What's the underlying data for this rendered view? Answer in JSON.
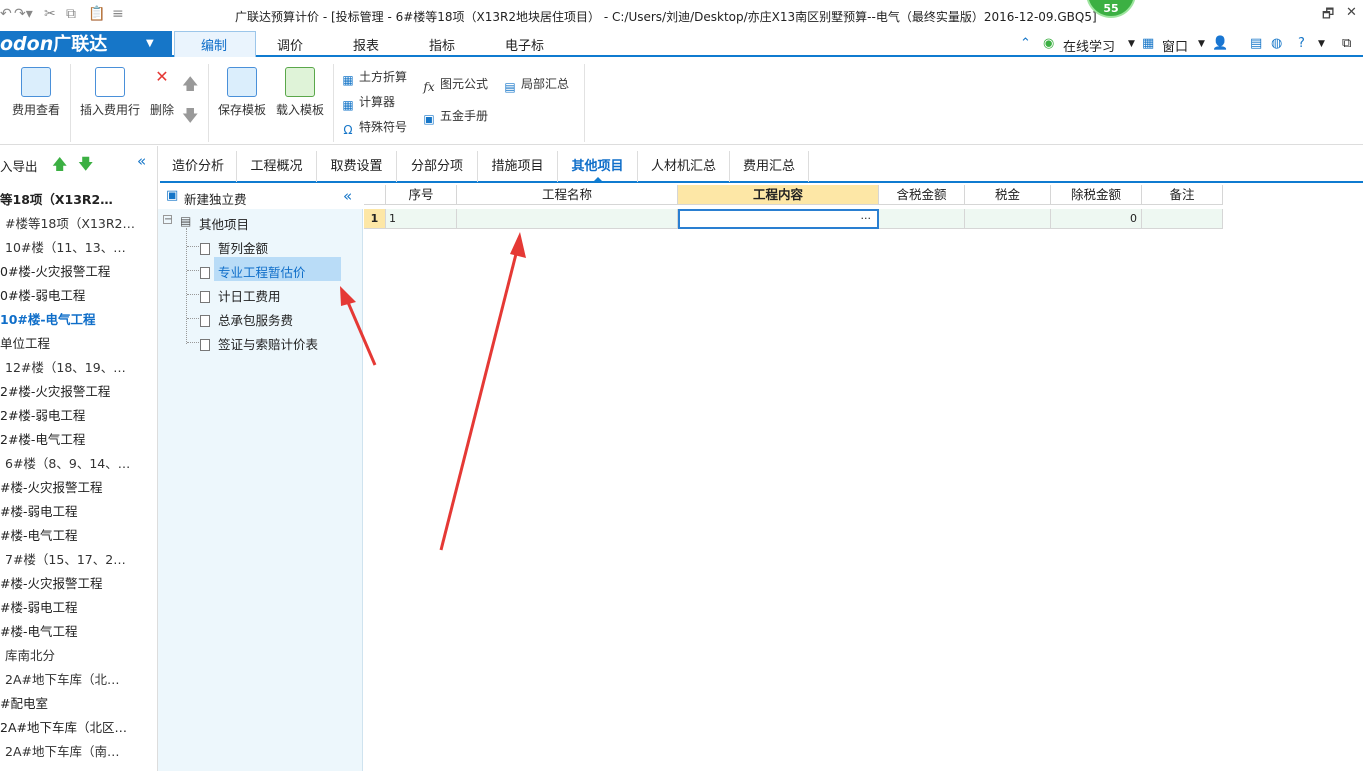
{
  "titlebar": {
    "title": "广联达预算计价 - [投标管理 - 6#楼等18项（X13R2地块居住项目） - C:/Users/刘迪/Desktop/亦庄X13南区别墅预算--电气（最终实量版）2016-12-09.GBQ5]",
    "badge": "55",
    "restore_icon": "restore-icon",
    "close_icon": "close-icon"
  },
  "menubar": {
    "logo_text": "odon",
    "logo_cn": "广联达",
    "items": [
      "编制",
      "调价",
      "报表",
      "指标",
      "电子标"
    ],
    "online_study": "在线学习",
    "window": "窗口",
    "help": "?"
  },
  "ribbon": {
    "fee_view": "费用查看",
    "insert_fee_row": "插入费用行",
    "delete": "删除",
    "save_template": "保存模板",
    "load_template": "载入模板",
    "earth_convert": "土方折算",
    "calculator": "计算器",
    "special_symbol": "特殊符号",
    "formula": "图元公式",
    "hardware_manual": "五金手册",
    "partial_summary": "局部汇总"
  },
  "leftpanel": {
    "toolbar_label": "入导出",
    "items": [
      {
        "text": "等18项（X13R2…",
        "style": "bold"
      },
      {
        "text": "#楼等18项（X13R2…",
        "style": "sub"
      },
      {
        "text": "10#楼（11、13、…",
        "style": "sub"
      },
      {
        "text": "0#楼-火灾报警工程",
        "style": "normal"
      },
      {
        "text": "0#楼-弱电工程",
        "style": "normal"
      },
      {
        "text": "10#楼-电气工程",
        "style": "blue"
      },
      {
        "text": "单位工程",
        "style": "normal"
      },
      {
        "text": "12#楼（18、19、…",
        "style": "sub"
      },
      {
        "text": "2#楼-火灾报警工程",
        "style": "normal"
      },
      {
        "text": "2#楼-弱电工程",
        "style": "normal"
      },
      {
        "text": "2#楼-电气工程",
        "style": "normal"
      },
      {
        "text": "6#楼（8、9、14、…",
        "style": "sub"
      },
      {
        "text": "#楼-火灾报警工程",
        "style": "normal"
      },
      {
        "text": "#楼-弱电工程",
        "style": "normal"
      },
      {
        "text": "#楼-电气工程",
        "style": "normal"
      },
      {
        "text": "7#楼（15、17、2…",
        "style": "sub"
      },
      {
        "text": "#楼-火灾报警工程",
        "style": "normal"
      },
      {
        "text": "#楼-弱电工程",
        "style": "normal"
      },
      {
        "text": "#楼-电气工程",
        "style": "normal"
      },
      {
        "text": "库南北分",
        "style": "sub"
      },
      {
        "text": "2A#地下车库（北…",
        "style": "sub"
      },
      {
        "text": "#配电室",
        "style": "normal"
      },
      {
        "text": "2A#地下车库（北区…",
        "style": "normal"
      },
      {
        "text": "2A#地下车库（南…",
        "style": "sub"
      }
    ]
  },
  "tabs": [
    "造价分析",
    "工程概况",
    "取费设置",
    "分部分项",
    "措施项目",
    "其他项目",
    "人材机汇总",
    "费用汇总"
  ],
  "tree": {
    "new_independent_fee": "新建独立费",
    "root": "其他项目",
    "children": [
      "暂列金额",
      "专业工程暂估价",
      "计日工费用",
      "总承包服务费",
      "签证与索赔计价表"
    ]
  },
  "grid": {
    "headers": [
      "序号",
      "工程名称",
      "工程内容",
      "含税金额",
      "税金",
      "除税金额",
      "备注"
    ],
    "row": {
      "num": "1",
      "seq": "1",
      "name": "",
      "content": "",
      "content_ellipsis": "···",
      "tax_incl": "",
      "tax": "",
      "tax_excl": "0",
      "remark": ""
    }
  },
  "colors": {
    "accent": "#0f7bd0",
    "selected_tree": "#b9dcf7",
    "header_highlight": "#fde7a6",
    "arrow": "#e53935"
  }
}
